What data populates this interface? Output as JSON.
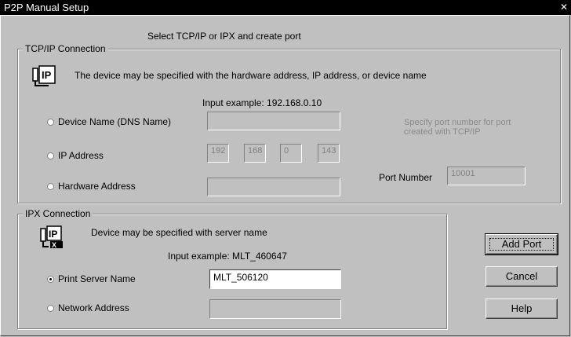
{
  "window": {
    "title": "P2P Manual Setup",
    "close_glyph": "✕"
  },
  "instruction": "Select TCP/IP or IPX and create port",
  "tcpip": {
    "legend": "TCP/IP Connection",
    "icon": "ip-network-icon",
    "description": "The device may be specified with the hardware address, IP address, or device name",
    "input_example": "Input example: 192.168.0.10",
    "options": {
      "device_name": {
        "label": "Device Name (DNS Name)",
        "value": "",
        "selected": false
      },
      "ip_address": {
        "label": "IP Address",
        "octets": [
          "192",
          "168",
          "0",
          "143"
        ],
        "selected": false
      },
      "hardware_address": {
        "label": "Hardware Address",
        "value": "",
        "selected": false
      }
    },
    "port_hint": "Specify port number for port created with TCP/IP",
    "port_number_label": "Port Number",
    "port_number_value": "10001"
  },
  "ipx": {
    "legend": "IPX Connection",
    "icon": "ipx-network-icon",
    "description": "Device may be specified with server name",
    "input_example": "Input example: MLT_460647",
    "options": {
      "print_server_name": {
        "label": "Print Server Name",
        "value": "MLT_506120",
        "selected": true
      },
      "network_address": {
        "label": "Network Address",
        "value": "",
        "selected": false
      }
    }
  },
  "buttons": {
    "add_port": "Add Port",
    "cancel": "Cancel",
    "help": "Help"
  },
  "colors": {
    "dialog_bg": "#c0c0c0",
    "titlebar_bg": "#000000",
    "disabled_text": "#8a8a8a"
  }
}
